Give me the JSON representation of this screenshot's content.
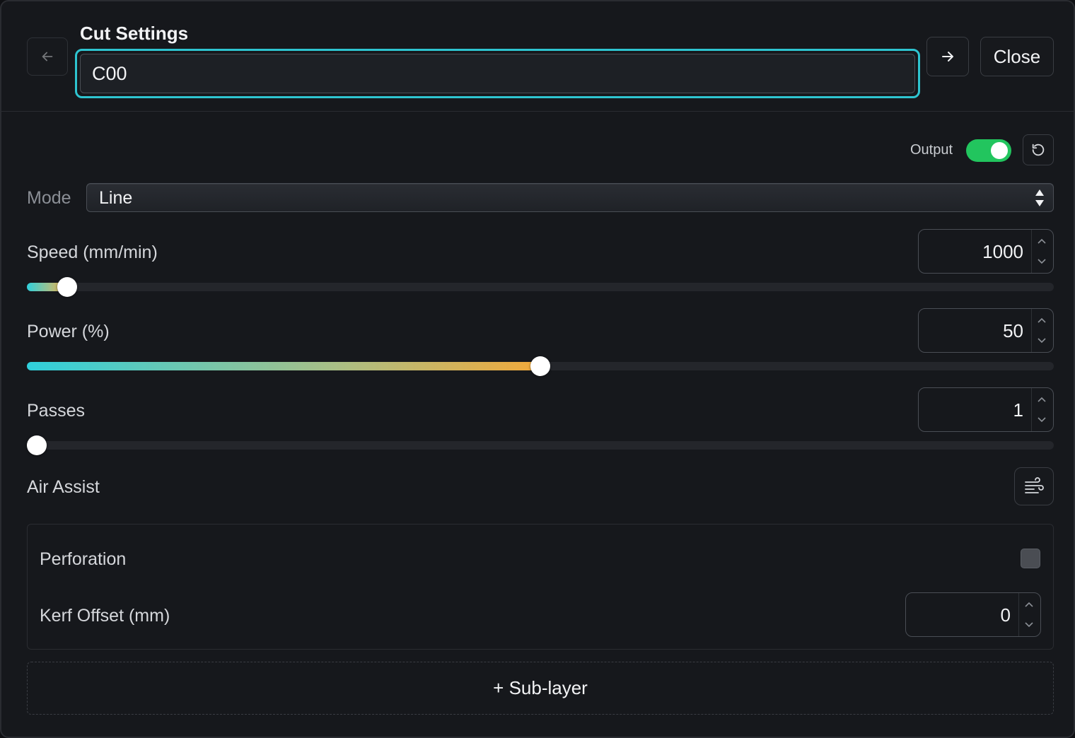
{
  "header": {
    "title": "Cut Settings",
    "name_value": "C00",
    "close_label": "Close"
  },
  "output": {
    "label": "Output",
    "enabled": true,
    "toggle_color": "#22c55e"
  },
  "mode": {
    "label": "Mode",
    "value": "Line"
  },
  "speed": {
    "label": "Speed (mm/min)",
    "value": "1000",
    "level": 0.03
  },
  "power": {
    "label": "Power (%)",
    "value": "50",
    "level": 0.5
  },
  "passes": {
    "label": "Passes",
    "value": "1",
    "level": 0.0
  },
  "air_assist": {
    "label": "Air Assist",
    "icon": "air-wind-icon"
  },
  "perforation": {
    "label": "Perforation",
    "checked": false
  },
  "kerf": {
    "label": "Kerf Offset (mm)",
    "value": "0"
  },
  "sublayer": {
    "label": "+ Sub-layer"
  },
  "colors": {
    "accent": "#2ec4d0",
    "slider_start": "#2fd0dc",
    "slider_end": "#f2a93a"
  }
}
